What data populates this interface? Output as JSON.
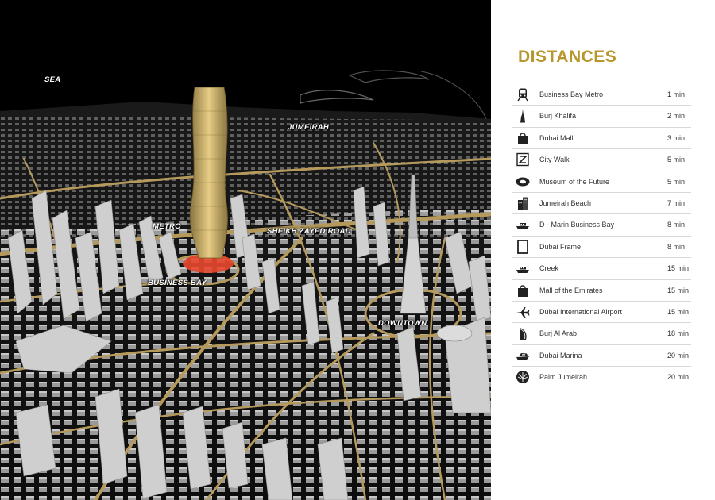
{
  "map": {
    "labels": {
      "sea": "SEA",
      "jumeirah": "JUMEIRAH",
      "metro": "METRO",
      "sheikh_zayed_road": "SHEIKH ZAYED ROAD",
      "business_bay": "BUSINESS BAY",
      "downtown": "DOWNTOWN"
    },
    "colors": {
      "background": "#000000",
      "roads": "#b59a5c",
      "buildings": "#d6d6d6",
      "tower_gold": "#d8bb72",
      "highlight": "#e8472c"
    }
  },
  "panel": {
    "title": "DISTANCES",
    "title_color": "#b8962e",
    "items": [
      {
        "icon": "train-icon",
        "name": "Business Bay Metro",
        "time": "1 min"
      },
      {
        "icon": "burj-khalifa-icon",
        "name": "Burj Khalifa",
        "time": "2 min"
      },
      {
        "icon": "shopping-bag-icon",
        "name": "Dubai Mall",
        "time": "3 min"
      },
      {
        "icon": "city-walk-icon",
        "name": "City Walk",
        "time": "5 min"
      },
      {
        "icon": "museum-icon",
        "name": "Museum of the Future",
        "time": "5 min"
      },
      {
        "icon": "building-icon",
        "name": "Jumeirah Beach",
        "time": "7  min"
      },
      {
        "icon": "boat-icon",
        "name": "D - Marin Business Bay",
        "time": "8  min"
      },
      {
        "icon": "frame-icon",
        "name": "Dubai Frame",
        "time": "8  min"
      },
      {
        "icon": "boat-icon",
        "name": "Creek",
        "time": "15 min"
      },
      {
        "icon": "shopping-bag-icon",
        "name": "Mall of the Emirates",
        "time": "15 min"
      },
      {
        "icon": "airplane-icon",
        "name": "Dubai International Airport",
        "time": "15 min"
      },
      {
        "icon": "burj-al-arab-icon",
        "name": "Burj Al Arab",
        "time": "18 min"
      },
      {
        "icon": "yacht-icon",
        "name": "Dubai Marina",
        "time": "20 min"
      },
      {
        "icon": "palm-icon",
        "name": "Palm Jumeirah",
        "time": "20 min"
      }
    ]
  }
}
